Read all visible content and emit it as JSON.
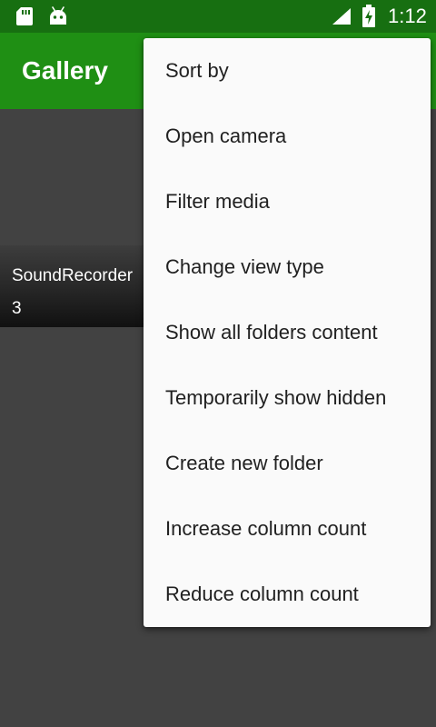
{
  "status_bar": {
    "time": "1:12",
    "icons": [
      "sd-card-icon",
      "android-icon",
      "signal-icon",
      "battery-charging-icon"
    ]
  },
  "toolbar": {
    "title": "Gallery"
  },
  "folders": [
    {
      "name": "SoundRecorder",
      "count": "3"
    }
  ],
  "menu": {
    "items": [
      {
        "label": "Sort by"
      },
      {
        "label": "Open camera"
      },
      {
        "label": "Filter media"
      },
      {
        "label": "Change view type"
      },
      {
        "label": "Show all folders content"
      },
      {
        "label": "Temporarily show hidden"
      },
      {
        "label": "Create new folder"
      },
      {
        "label": "Increase column count"
      },
      {
        "label": "Reduce column count"
      }
    ]
  },
  "colors": {
    "status_bar": "#176f11",
    "toolbar": "#1f8f14",
    "background": "#424242",
    "menu_background": "#fafafa",
    "menu_text": "#212121"
  }
}
